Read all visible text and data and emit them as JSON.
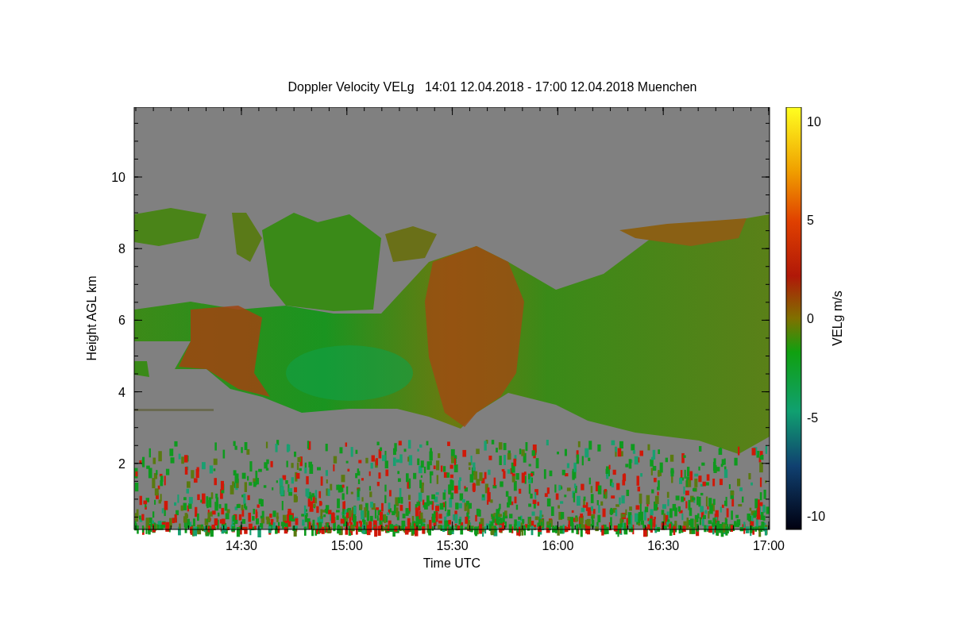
{
  "title": "Doppler Velocity VELg   14:01 12.04.2018 - 17:00 12.04.2018 Muenchen",
  "y_axis": {
    "label": "Height AGL km",
    "ticks": [
      "10",
      "8",
      "6",
      "4",
      "2"
    ]
  },
  "x_axis": {
    "label": "Time UTC",
    "ticks": [
      "14:30",
      "15:00",
      "15:30",
      "16:00",
      "16:30",
      "17:00"
    ]
  },
  "colorbar": {
    "label": "VELg m/s",
    "ticks": [
      "10",
      "5",
      "0",
      "-5",
      "-10"
    ]
  }
}
